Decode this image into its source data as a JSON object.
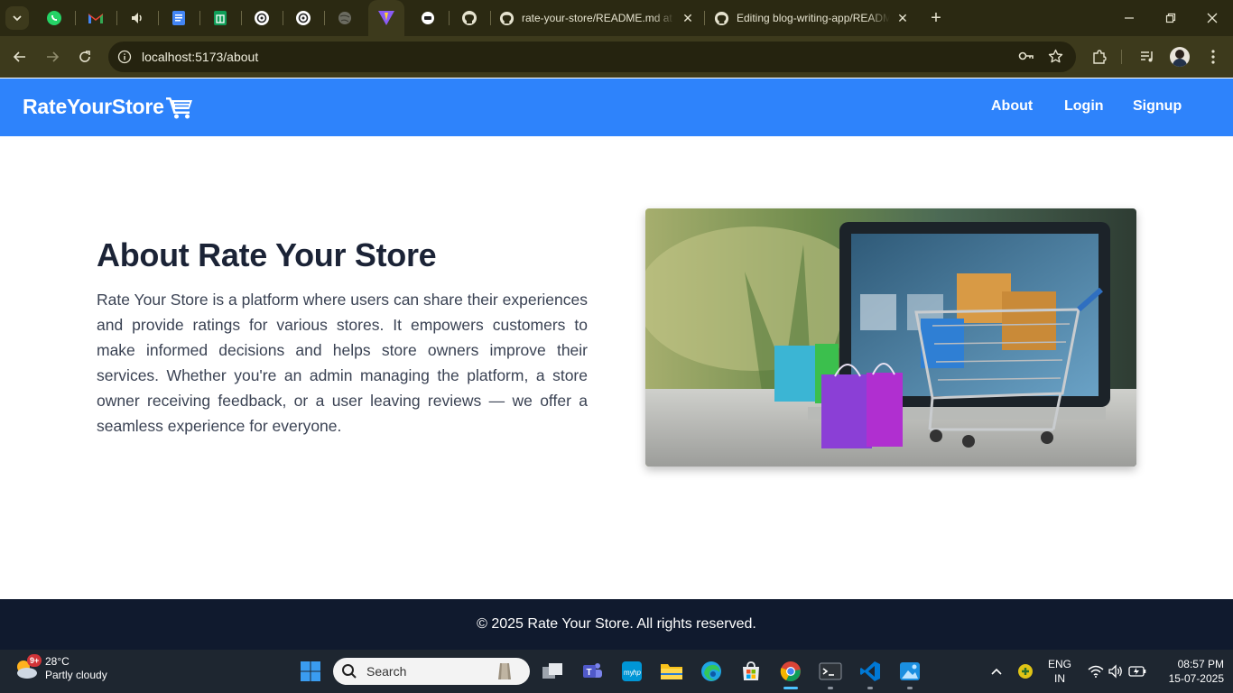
{
  "browser": {
    "tabs": [
      {
        "title": "rate-your-store/README.md at",
        "icon": "github-icon"
      },
      {
        "title": "Editing blog-writing-app/README",
        "icon": "github-icon"
      }
    ],
    "pinned_tabs": [
      "whatsapp-icon",
      "gmail-icon",
      "audio-icon",
      "docs-icon",
      "sheets-icon",
      "chatgpt-icon",
      "chatgpt-icon",
      "globe-icon",
      "vite-icon",
      "circle-icon",
      "github-icon"
    ],
    "url": "localhost:5173/about"
  },
  "navbar": {
    "brand": "RateYourStore",
    "links": [
      "About",
      "Login",
      "Signup"
    ],
    "bg_color": "#2e83fb"
  },
  "about": {
    "title": "About Rate Your Store",
    "text": "Rate Your Store is a platform where users can share their experiences and provide ratings for various stores. It empowers customers to make informed decisions and helps store owners improve their services. Whether you're an admin managing the platform, a store owner receiving feedback, or a user leaving reviews — we offer a seamless experience for everyone."
  },
  "footer": {
    "text": "© 2025 Rate Your Store. All rights reserved.",
    "bg_color": "#101a2e"
  },
  "taskbar": {
    "weather_temp": "28°C",
    "weather_desc": "Partly cloudy",
    "weather_badge": "9+",
    "search_label": "Search",
    "lang_line1": "ENG",
    "lang_line2": "IN",
    "time": "08:57 PM",
    "date": "15-07-2025"
  }
}
